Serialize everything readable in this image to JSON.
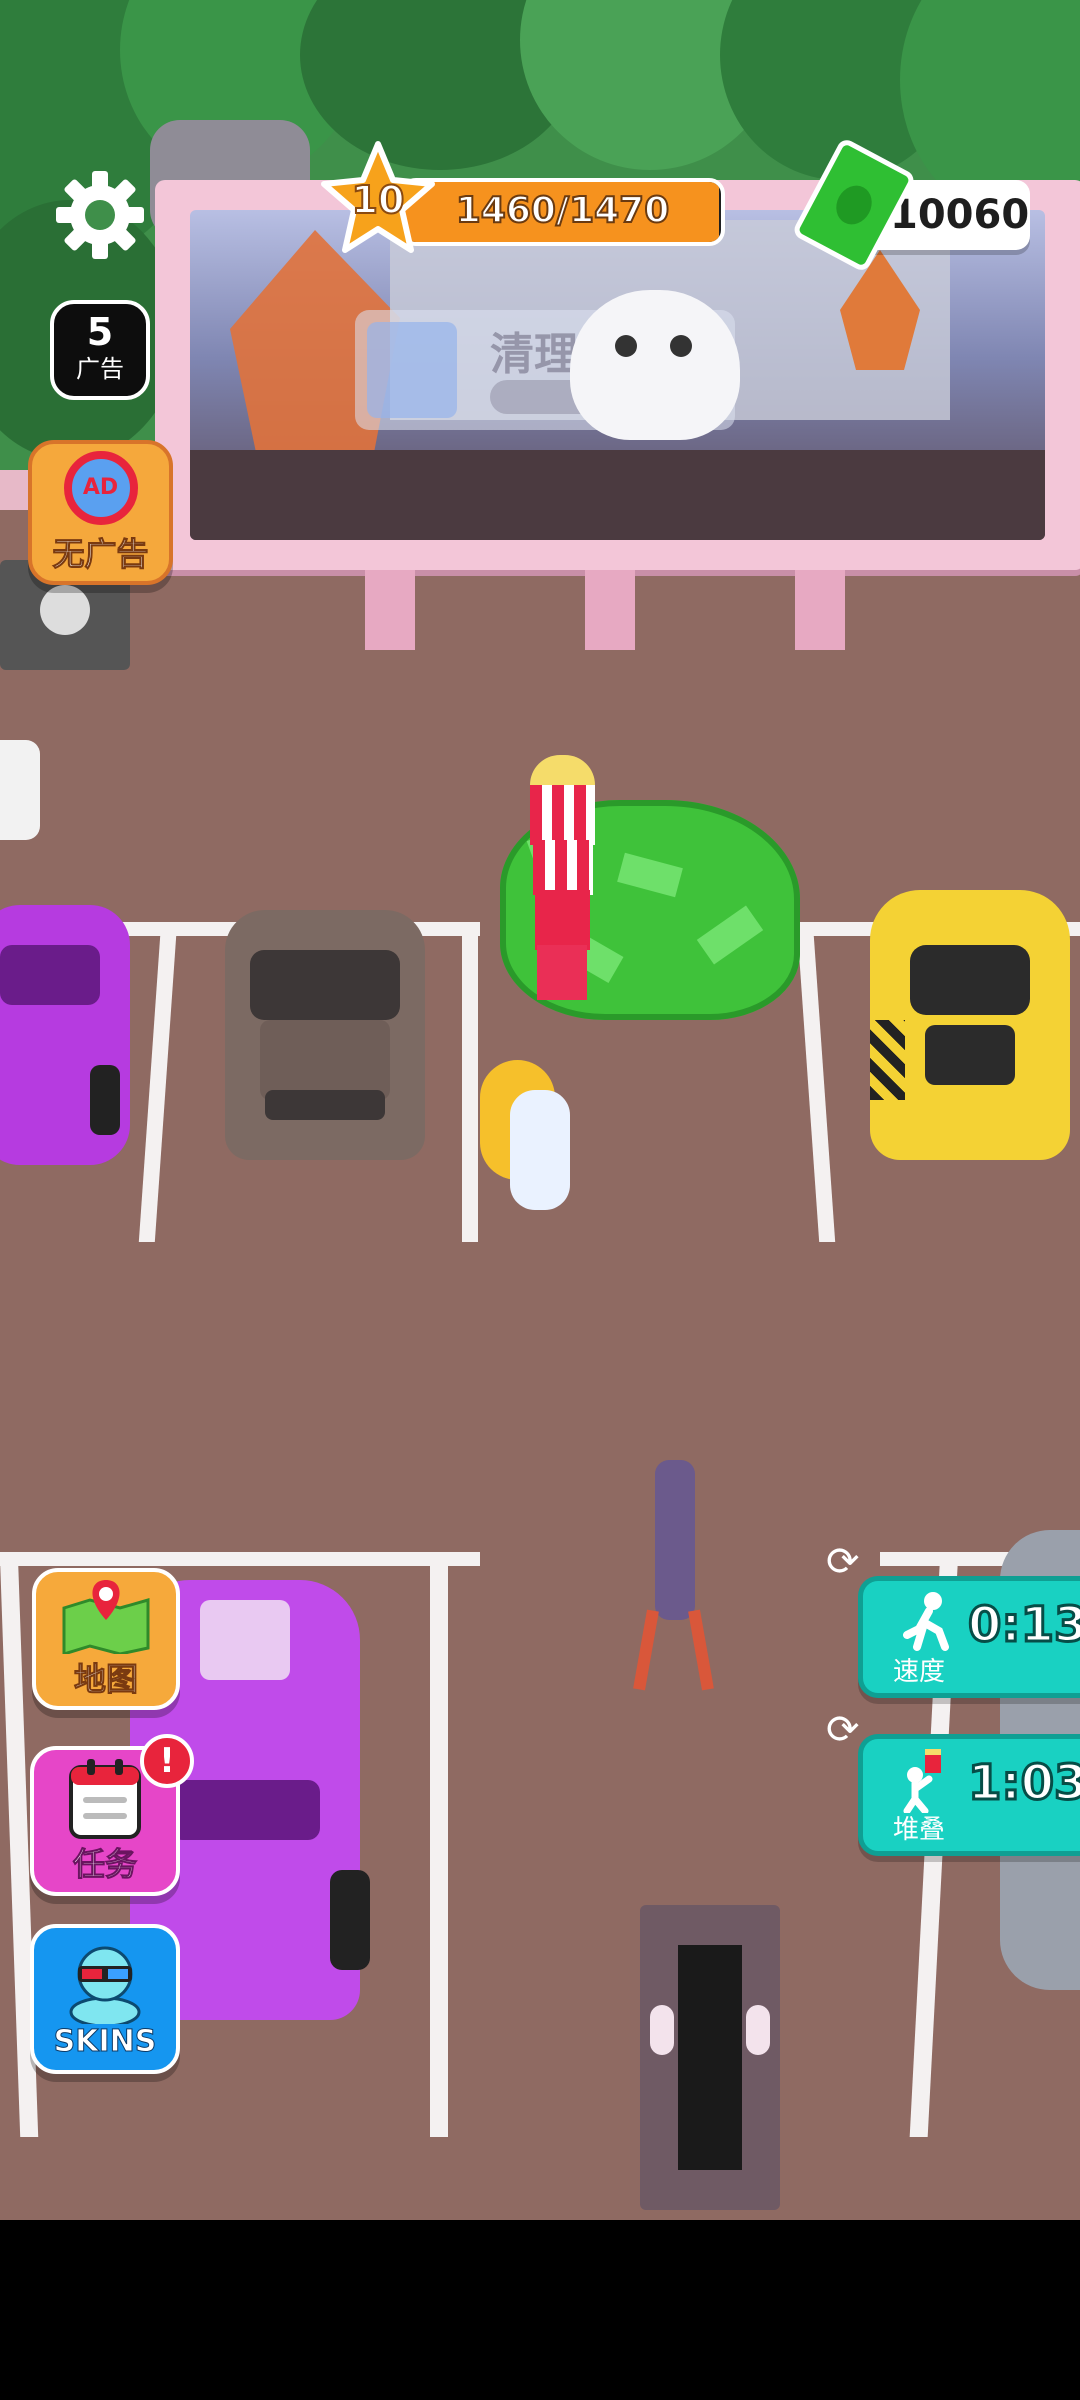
{
  "hud": {
    "level": "10",
    "xp_text": "1460/1470",
    "xp_progress": 0.993,
    "cash": "10060"
  },
  "left_panel": {
    "ad_count": "5",
    "ad_label": "广告",
    "no_ads_label": "无广告",
    "no_ads_icon_text": "AD",
    "map_label": "地图",
    "tasks_label": "任务",
    "tasks_badge": "!",
    "skins_label": "SKINS"
  },
  "billboard": {
    "task_title": "清理停车场",
    "task_progress": "0/3"
  },
  "boosts": [
    {
      "time": "0:13",
      "label": "速度",
      "icon": "runner-icon"
    },
    {
      "time": "1:03",
      "label": "堆叠",
      "icon": "popcorn-runner-icon"
    }
  ],
  "colors": {
    "ground": "#8f6a62",
    "xp_bar": "#f6921e",
    "star": "#f7a21b",
    "cash_green": "#2fbf33",
    "boost_teal": "#19d1c2",
    "map_btn": "#f6a93b",
    "tasks_btn": "#e646c8",
    "skins_btn": "#1596f0"
  }
}
